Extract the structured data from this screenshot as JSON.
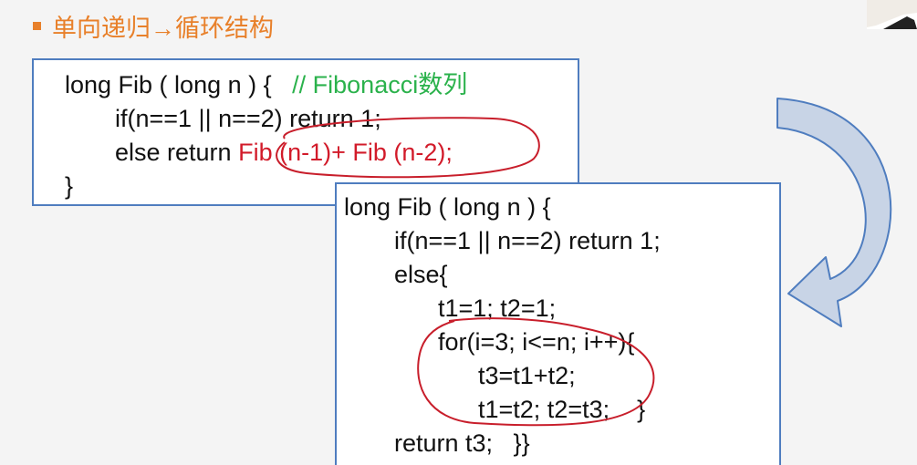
{
  "heading": {
    "title": "单向递归→循环结构"
  },
  "recursive_code": {
    "line_0": "long Fib ( long n ) {",
    "line_0_comment": "// Fibonacci数列",
    "line_1": "if(n==1 || n==2) return 1;",
    "line_2_prefix": "else return ",
    "line_2_red": "Fib (n-1)+ Fib (n-2);",
    "line_3": "}"
  },
  "loop_code": {
    "line_0": "long Fib ( long n ) {",
    "line_1": "if(n==1 || n==2) return 1;",
    "line_2": "else{",
    "line_3": "t1=1; t2=1;",
    "line_4": "for(i=3; i<=n; i++){",
    "line_5": "t3=t1+t2;",
    "line_6": "t1=t2; t2=t3;    }",
    "line_7": "return t3;   }}"
  },
  "colors": {
    "accent": "#e8802a",
    "box_border": "#4f7dbf",
    "comment": "#2bb24c",
    "annotation_red": "#d21b2a",
    "arrow_fill": "#c8d4e6"
  }
}
